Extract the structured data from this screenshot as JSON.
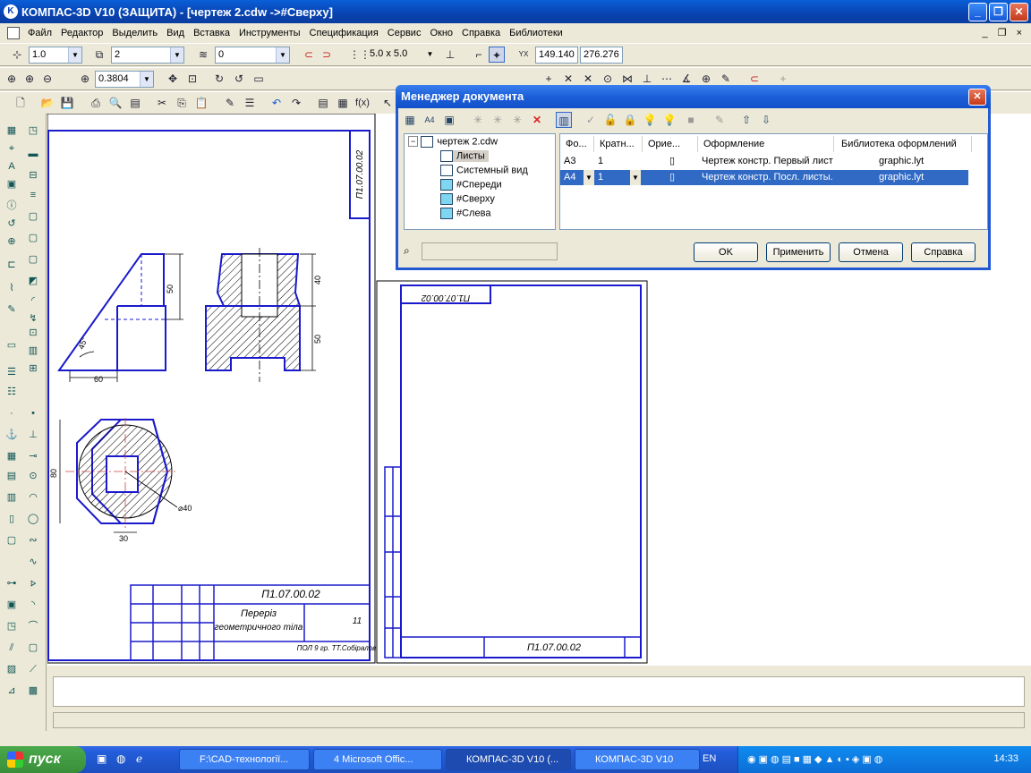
{
  "window": {
    "title": "КОМПАС-3D V10 (ЗАЩИТА) - [чертеж 2.cdw ->#Сверху]",
    "minimize": "_",
    "maximize": "❐",
    "close": "✕"
  },
  "menu": {
    "items": [
      "Файл",
      "Редактор",
      "Выделить",
      "Вид",
      "Вставка",
      "Инструменты",
      "Спецификация",
      "Сервис",
      "Окно",
      "Справка",
      "Библиотеки"
    ],
    "mdi_controls": "_ ❐ ×"
  },
  "toolbar1": {
    "step": "1.0",
    "layer": "2",
    "style": "0",
    "grid": "5.0 x 5.0",
    "coord_x": "149.140",
    "coord_y": "276.276"
  },
  "toolbar2": {
    "zoom": "0.3804"
  },
  "dialog": {
    "title": "Менеджер документа",
    "tree": {
      "root": "чертеж 2.cdw",
      "items": [
        "Листы",
        "Системный вид",
        "#Спереди",
        "#Сверху",
        "#Слева"
      ]
    },
    "columns": [
      "Фо...",
      "Кратн...",
      "Орие...",
      "Оформление",
      "Библиотека оформлений"
    ],
    "rows": [
      {
        "format": "A3",
        "mult": "1",
        "layout": "Чертеж констр. Первый лист",
        "lib": "graphic.lyt"
      },
      {
        "format": "A4",
        "mult": "1",
        "layout": "Чертеж констр. Посл. листы.",
        "lib": "graphic.lyt"
      }
    ],
    "buttons": {
      "ok": "OK",
      "apply": "Применить",
      "cancel": "Отмена",
      "help": "Справка"
    }
  },
  "drawing": {
    "code": "П1.07.00.02",
    "title_line1": "Переріз",
    "title_line2": "геометричного тіла",
    "sheet_num": "11",
    "group": "ПОЛ 9 гр. ТТ.Собіралов",
    "dims": {
      "d50a": "50",
      "d60": "60",
      "d45": "45°",
      "d40": "40",
      "d50b": "50",
      "d80": "80",
      "d40b": "⌀40",
      "d30": "30"
    }
  },
  "taskbar": {
    "start": "пуск",
    "tasks": [
      "F:\\CAD-технології...",
      "4 Microsoft Offic...",
      "КОМПАС-3D V10 (...",
      "КОМПАС-3D V10"
    ],
    "lang": "EN",
    "clock": "14:33"
  }
}
